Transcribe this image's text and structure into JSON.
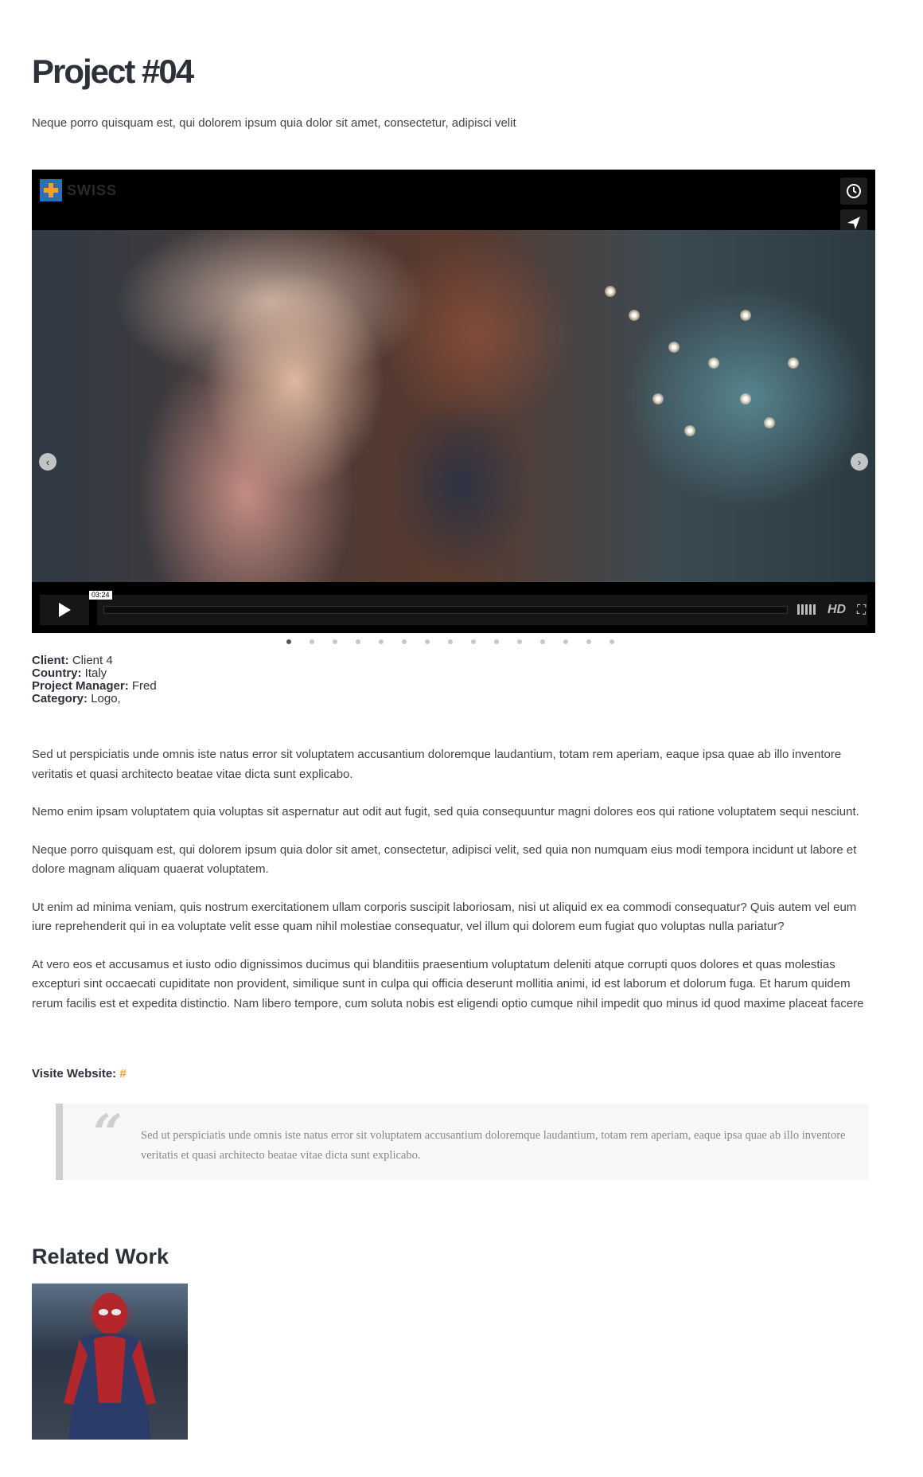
{
  "page": {
    "title": "Project #04",
    "lead": "Neque porro quisquam est, qui dolorem ipsum quia dolor sit amet, consectetur, adipisci velit"
  },
  "player": {
    "brand": "SWISS",
    "timestamp": "03:24",
    "hd_label": "HD",
    "progress": 0.0,
    "icons": [
      "clock-icon",
      "send-icon",
      "play-icon",
      "volume-icon",
      "fullscreen-icon",
      "arrow-left-icon",
      "arrow-right-icon"
    ],
    "slides_count": 15,
    "active_slide": 1
  },
  "meta": {
    "client_label": "Client:",
    "client_value": "Client 4",
    "country_label": "Country:",
    "country_value": "Italy",
    "pm_label": "Project Manager:",
    "pm_value": "Fred",
    "category_label": "Category:",
    "category_value": "Logo,"
  },
  "body": {
    "paragraphs": [
      "Sed ut perspiciatis unde omnis iste natus error sit voluptatem accusantium doloremque laudantium, totam rem aperiam, eaque ipsa quae ab illo inventore veritatis et quasi architecto beatae vitae dicta sunt explicabo.",
      "Nemo enim ipsam voluptatem quia voluptas sit aspernatur aut odit aut fugit, sed quia consequuntur magni dolores eos qui ratione voluptatem sequi nesciunt.",
      "Neque porro quisquam est, qui dolorem ipsum quia dolor sit amet, consectetur, adipisci velit, sed quia non numquam eius modi tempora incidunt ut labore et dolore magnam aliquam quaerat voluptatem.",
      "Ut enim ad minima veniam, quis nostrum exercitationem ullam corporis suscipit laboriosam, nisi ut aliquid ex ea commodi consequatur? Quis autem vel eum iure reprehenderit qui in ea voluptate velit esse quam nihil molestiae consequatur, vel illum qui dolorem eum fugiat quo voluptas nulla pariatur?",
      "At vero eos et accusamus et iusto odio dignissimos ducimus qui blanditiis praesentium voluptatum deleniti atque corrupti quos dolores et quas molestias excepturi sint occaecati cupiditate non provident, similique sunt in culpa qui officia deserunt mollitia animi, id est laborum et dolorum fuga. Et harum quidem rerum facilis est et expedita distinctio. Nam libero tempore, cum soluta nobis est eligendi optio cumque nihil impedit quo minus id quod maxime placeat facere"
    ]
  },
  "visit": {
    "label": "Visite Website:",
    "link": "#"
  },
  "quote": {
    "mark": "“",
    "text": "Sed ut perspiciatis unde omnis iste natus error sit voluptatem accusantium doloremque laudantium, totam rem aperiam, eaque ipsa quae ab illo inventore veritatis et quasi architecto beatae vitae dicta sunt explicabo."
  },
  "related": {
    "title": "Related Work"
  },
  "colors": {
    "heading": "#2c313a",
    "accent": "#f59d1a",
    "quote_bg": "#f7f7f7"
  }
}
